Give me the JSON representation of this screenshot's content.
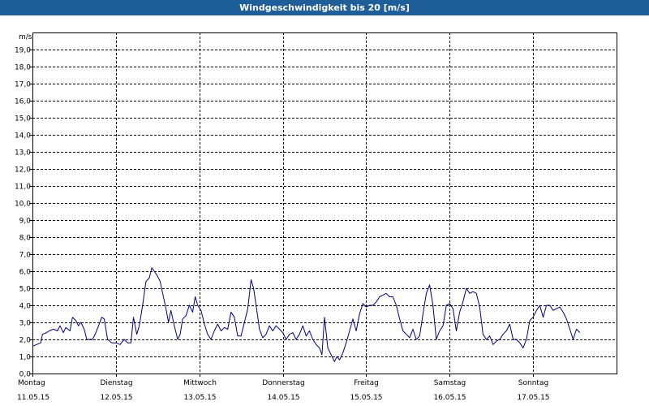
{
  "window": {
    "title": "Windgeschwindigkeit bis 20 [m/s]"
  },
  "colors": {
    "titlebar": "#1f5f99",
    "line": "#000080",
    "grid": "#000000"
  },
  "chart_data": {
    "type": "line",
    "title": "Windgeschwindigkeit bis 20 [m/s]",
    "ylabel": "m/s",
    "ylim": [
      0,
      20
    ],
    "yticks": [
      "0,0",
      "1,0",
      "2,0",
      "3,0",
      "4,0",
      "5,0",
      "6,0",
      "7,0",
      "8,0",
      "9,0",
      "10,0",
      "11,0",
      "12,0",
      "13,0",
      "14,0",
      "15,0",
      "16,0",
      "17,0",
      "18,0",
      "19,0"
    ],
    "xlim": [
      0,
      7
    ],
    "x_unit": "days since Montag 11.05.15",
    "grid": true,
    "days": [
      {
        "name": "Montag",
        "date": "11.05.15"
      },
      {
        "name": "Dienstag",
        "date": "12.05.15"
      },
      {
        "name": "Mittwoch",
        "date": "13.05.15"
      },
      {
        "name": "Donnerstag",
        "date": "14.05.15"
      },
      {
        "name": "Freitag",
        "date": "15.05.15"
      },
      {
        "name": "Samstag",
        "date": "16.05.15"
      },
      {
        "name": "Sonntag",
        "date": "17.05.15"
      }
    ],
    "series": [
      {
        "values": [
          [
            0.0,
            1.6
          ],
          [
            0.05,
            1.7
          ],
          [
            0.1,
            1.8
          ],
          [
            0.12,
            2.3
          ],
          [
            0.17,
            2.4
          ],
          [
            0.2,
            2.5
          ],
          [
            0.25,
            2.6
          ],
          [
            0.3,
            2.5
          ],
          [
            0.33,
            2.8
          ],
          [
            0.37,
            2.4
          ],
          [
            0.4,
            2.7
          ],
          [
            0.45,
            2.5
          ],
          [
            0.48,
            3.3
          ],
          [
            0.52,
            3.1
          ],
          [
            0.55,
            2.8
          ],
          [
            0.58,
            3.0
          ],
          [
            0.62,
            2.6
          ],
          [
            0.65,
            2.0
          ],
          [
            0.72,
            2.0
          ],
          [
            0.76,
            2.4
          ],
          [
            0.8,
            2.9
          ],
          [
            0.83,
            3.3
          ],
          [
            0.86,
            3.2
          ],
          [
            0.9,
            2.0
          ],
          [
            0.95,
            1.8
          ],
          [
            1.0,
            1.8
          ],
          [
            1.05,
            1.7
          ],
          [
            1.1,
            2.0
          ],
          [
            1.14,
            1.8
          ],
          [
            1.18,
            1.8
          ],
          [
            1.21,
            3.3
          ],
          [
            1.25,
            2.3
          ],
          [
            1.28,
            2.8
          ],
          [
            1.32,
            4.0
          ],
          [
            1.36,
            5.4
          ],
          [
            1.4,
            5.6
          ],
          [
            1.43,
            6.2
          ],
          [
            1.46,
            6.0
          ],
          [
            1.5,
            5.7
          ],
          [
            1.53,
            5.4
          ],
          [
            1.56,
            4.7
          ],
          [
            1.6,
            3.8
          ],
          [
            1.63,
            3.0
          ],
          [
            1.66,
            3.7
          ],
          [
            1.7,
            2.8
          ],
          [
            1.74,
            2.0
          ],
          [
            1.77,
            2.3
          ],
          [
            1.8,
            3.2
          ],
          [
            1.84,
            3.4
          ],
          [
            1.88,
            4.0
          ],
          [
            1.92,
            3.6
          ],
          [
            1.95,
            4.5
          ],
          [
            1.98,
            4.0
          ],
          [
            2.02,
            3.7
          ],
          [
            2.06,
            2.9
          ],
          [
            2.1,
            2.3
          ],
          [
            2.14,
            2.0
          ],
          [
            2.18,
            2.5
          ],
          [
            2.22,
            2.9
          ],
          [
            2.26,
            2.5
          ],
          [
            2.3,
            2.7
          ],
          [
            2.34,
            2.6
          ],
          [
            2.38,
            3.6
          ],
          [
            2.42,
            3.3
          ],
          [
            2.46,
            2.2
          ],
          [
            2.5,
            2.2
          ],
          [
            2.54,
            3.0
          ],
          [
            2.58,
            3.8
          ],
          [
            2.62,
            5.5
          ],
          [
            2.65,
            5.0
          ],
          [
            2.68,
            4.0
          ],
          [
            2.72,
            2.6
          ],
          [
            2.76,
            2.1
          ],
          [
            2.8,
            2.3
          ],
          [
            2.84,
            2.8
          ],
          [
            2.88,
            2.5
          ],
          [
            2.92,
            2.8
          ],
          [
            2.96,
            2.6
          ],
          [
            3.0,
            2.4
          ],
          [
            3.04,
            2.0
          ],
          [
            3.08,
            2.3
          ],
          [
            3.12,
            2.4
          ],
          [
            3.16,
            2.0
          ],
          [
            3.2,
            2.3
          ],
          [
            3.24,
            2.8
          ],
          [
            3.28,
            2.2
          ],
          [
            3.32,
            2.5
          ],
          [
            3.36,
            2.0
          ],
          [
            3.4,
            1.7
          ],
          [
            3.44,
            1.5
          ],
          [
            3.47,
            1.1
          ],
          [
            3.5,
            3.3
          ],
          [
            3.54,
            1.5
          ],
          [
            3.58,
            1.1
          ],
          [
            3.62,
            0.7
          ],
          [
            3.65,
            1.0
          ],
          [
            3.68,
            0.8
          ],
          [
            3.72,
            1.2
          ],
          [
            3.76,
            1.8
          ],
          [
            3.8,
            2.5
          ],
          [
            3.84,
            3.2
          ],
          [
            3.88,
            2.5
          ],
          [
            3.92,
            3.5
          ],
          [
            3.96,
            4.1
          ],
          [
            4.0,
            3.9
          ],
          [
            4.04,
            4.0
          ],
          [
            4.08,
            4.0
          ],
          [
            4.12,
            4.2
          ],
          [
            4.16,
            4.5
          ],
          [
            4.2,
            4.6
          ],
          [
            4.24,
            4.7
          ],
          [
            4.28,
            4.5
          ],
          [
            4.32,
            4.5
          ],
          [
            4.36,
            4.0
          ],
          [
            4.4,
            3.2
          ],
          [
            4.44,
            2.5
          ],
          [
            4.48,
            2.3
          ],
          [
            4.52,
            2.1
          ],
          [
            4.56,
            2.6
          ],
          [
            4.6,
            2.0
          ],
          [
            4.64,
            2.2
          ],
          [
            4.68,
            3.5
          ],
          [
            4.72,
            4.7
          ],
          [
            4.76,
            5.2
          ],
          [
            4.8,
            4.0
          ],
          [
            4.84,
            2.0
          ],
          [
            4.88,
            2.5
          ],
          [
            4.92,
            2.8
          ],
          [
            4.96,
            4.0
          ],
          [
            5.0,
            4.1
          ],
          [
            5.04,
            3.8
          ],
          [
            5.08,
            2.5
          ],
          [
            5.12,
            3.6
          ],
          [
            5.16,
            4.2
          ],
          [
            5.2,
            5.0
          ],
          [
            5.24,
            4.7
          ],
          [
            5.28,
            4.8
          ],
          [
            5.32,
            4.7
          ],
          [
            5.36,
            3.9
          ],
          [
            5.4,
            2.3
          ],
          [
            5.44,
            2.0
          ],
          [
            5.48,
            2.2
          ],
          [
            5.52,
            1.7
          ],
          [
            5.56,
            1.9
          ],
          [
            5.6,
            2.0
          ],
          [
            5.64,
            2.3
          ],
          [
            5.68,
            2.5
          ],
          [
            5.72,
            2.9
          ],
          [
            5.76,
            2.0
          ],
          [
            5.8,
            2.0
          ],
          [
            5.84,
            1.8
          ],
          [
            5.88,
            1.5
          ],
          [
            5.92,
            2.0
          ],
          [
            5.96,
            3.1
          ],
          [
            6.0,
            3.3
          ],
          [
            6.04,
            3.7
          ],
          [
            6.08,
            4.0
          ],
          [
            6.12,
            3.3
          ],
          [
            6.16,
            4.0
          ],
          [
            6.2,
            4.0
          ],
          [
            6.24,
            3.7
          ],
          [
            6.28,
            3.8
          ],
          [
            6.32,
            3.9
          ],
          [
            6.36,
            3.6
          ],
          [
            6.4,
            3.2
          ],
          [
            6.44,
            2.6
          ],
          [
            6.48,
            2.0
          ],
          [
            6.52,
            2.6
          ],
          [
            6.56,
            2.4
          ]
        ]
      }
    ]
  }
}
